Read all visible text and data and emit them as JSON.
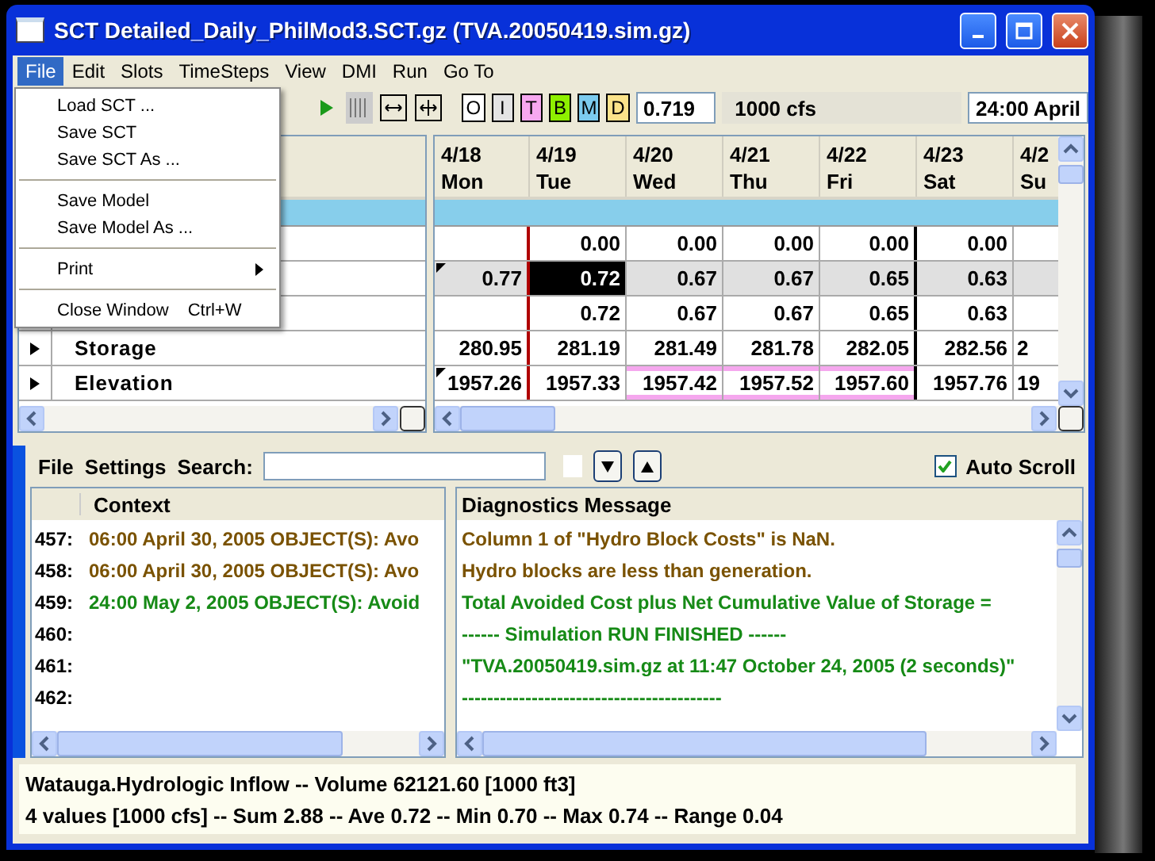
{
  "window": {
    "title": "SCT Detailed_Daily_PhilMod3.SCT.gz (TVA.20050419.sim.gz)"
  },
  "menu_bar": [
    {
      "label": "File",
      "selected": true
    },
    {
      "label": "Edit",
      "selected": false
    },
    {
      "label": "Slots",
      "selected": false
    },
    {
      "label": "TimeSteps",
      "selected": false
    },
    {
      "label": "View",
      "selected": false
    },
    {
      "label": "DMI",
      "selected": false
    },
    {
      "label": "Run",
      "selected": false
    },
    {
      "label": "Go To",
      "selected": false
    }
  ],
  "file_menu": [
    {
      "kind": "item",
      "label": "Load SCT ..."
    },
    {
      "kind": "item",
      "label": "Save SCT"
    },
    {
      "kind": "item",
      "label": "Save SCT As ..."
    },
    {
      "kind": "separator"
    },
    {
      "kind": "item",
      "label": "Save Model"
    },
    {
      "kind": "item",
      "label": "Save Model As ..."
    },
    {
      "kind": "separator"
    },
    {
      "kind": "submenu",
      "label": "Print"
    },
    {
      "kind": "separator"
    },
    {
      "kind": "item",
      "label": "Close Window",
      "shortcut": "Ctrl+W"
    }
  ],
  "toolbar": {
    "filters": [
      {
        "label": "O",
        "color": "#ffffff"
      },
      {
        "label": "I",
        "color": "#e4e4e4"
      },
      {
        "label": "T",
        "color": "#f7a8f0"
      },
      {
        "label": "B",
        "color": "#8ef000"
      },
      {
        "label": "M",
        "color": "#7ccbef"
      },
      {
        "label": "D",
        "color": "#fbe38a"
      }
    ],
    "value": "0.719",
    "units": "1000 cfs",
    "date": "24:00 April"
  },
  "table": {
    "columns": [
      {
        "date": "4/18",
        "day": "Mon"
      },
      {
        "date": "4/19",
        "day": "Tue"
      },
      {
        "date": "4/20",
        "day": "Wed"
      },
      {
        "date": "4/21",
        "day": "Thu"
      },
      {
        "date": "4/22",
        "day": "Fri"
      },
      {
        "date": "4/23",
        "day": "Sat"
      },
      {
        "date": "4/2",
        "day": "Su"
      }
    ],
    "rows": [
      {
        "expandable": false,
        "shaded": false,
        "cells": [
          null,
          {
            "text": "0.00",
            "kind": "plain",
            "selected": false
          },
          {
            "text": "0.00",
            "kind": "plain",
            "selected": false
          },
          {
            "text": "0.00",
            "kind": "plain",
            "selected": false
          },
          {
            "text": "0.00",
            "kind": "plain",
            "selected": false
          },
          {
            "text": "0.00",
            "kind": "plain",
            "selected": false
          },
          null
        ]
      },
      {
        "expandable": false,
        "shaded": true,
        "cells": [
          {
            "text": "0.77",
            "kind": "flagged",
            "selected": false
          },
          {
            "text": "0.72",
            "kind": "plain",
            "selected": true
          },
          {
            "text": "0.67",
            "kind": "plain",
            "selected": false
          },
          {
            "text": "0.67",
            "kind": "plain",
            "selected": false
          },
          {
            "text": "0.65",
            "kind": "plain",
            "selected": false
          },
          {
            "text": "0.63",
            "kind": "plain",
            "selected": false
          },
          null
        ]
      },
      {
        "expandable": false,
        "shaded": false,
        "cells": [
          null,
          {
            "text": "0.72",
            "kind": "plain",
            "selected": false
          },
          {
            "text": "0.67",
            "kind": "plain",
            "selected": false
          },
          {
            "text": "0.67",
            "kind": "plain",
            "selected": false
          },
          {
            "text": "0.65",
            "kind": "plain",
            "selected": false
          },
          {
            "text": "0.63",
            "kind": "plain",
            "selected": false
          },
          null
        ]
      },
      {
        "label": "Storage",
        "expandable": true,
        "shaded": false,
        "cells": [
          {
            "text": "280.95",
            "kind": "plain",
            "selected": false
          },
          {
            "text": "281.19",
            "kind": "plain",
            "selected": false
          },
          {
            "text": "281.49",
            "kind": "plain",
            "selected": false
          },
          {
            "text": "281.78",
            "kind": "plain",
            "selected": false
          },
          {
            "text": "282.05",
            "kind": "plain",
            "selected": false
          },
          {
            "text": "282.56",
            "kind": "plain",
            "selected": false
          },
          {
            "text": "2",
            "kind": "plain",
            "selected": false
          }
        ]
      },
      {
        "label": "Elevation",
        "expandable": true,
        "shaded": false,
        "cells": [
          {
            "text": "1957.26",
            "kind": "flagged",
            "selected": false
          },
          {
            "text": "1957.33",
            "kind": "plain",
            "selected": false
          },
          {
            "text": "1957.42",
            "kind": "highlighted",
            "selected": false
          },
          {
            "text": "1957.52",
            "kind": "highlighted",
            "selected": false
          },
          {
            "text": "1957.60",
            "kind": "highlighted",
            "selected": false
          },
          {
            "text": "1957.76",
            "kind": "plain",
            "selected": false
          },
          {
            "text": "19",
            "kind": "plain",
            "selected": false
          }
        ]
      }
    ]
  },
  "diagnostics": {
    "menu": [
      "File",
      "Settings"
    ],
    "search_label": "Search:",
    "auto_scroll": {
      "label": "Auto Scroll",
      "checked": true
    },
    "context_header": "Context",
    "message_header": "Diagnostics Message",
    "lines": [
      {
        "number": "457:",
        "context": "06:00 April 30, 2005 OBJECT(S): Avo",
        "message": "Column 1 of \"Hydro Block Costs\" is NaN.",
        "color": "#7a5200"
      },
      {
        "number": "458:",
        "context": "06:00 April 30, 2005 OBJECT(S): Avo",
        "message": "Hydro blocks are less than generation.",
        "color": "#7a5200"
      },
      {
        "number": "459:",
        "context": "24:00 May 2, 2005 OBJECT(S): Avoid",
        "message": "Total Avoided Cost plus Net Cumulative Value of Storage =",
        "color": "#168a16"
      },
      {
        "number": "460:",
        "message": "------ Simulation RUN FINISHED ------",
        "color": "#168a16"
      },
      {
        "number": "461:",
        "message": "\"TVA.20050419.sim.gz at 11:47 October 24, 2005 (2 seconds)\"",
        "color": "#168a16"
      },
      {
        "number": "462:",
        "message": "-----------------------------------------",
        "color": "#168a16"
      }
    ]
  },
  "status": [
    "Watauga.Hydrologic Inflow -- Volume 62121.60 [1000 ft3]",
    "4 values [1000 cfs] -- Sum 2.88 -- Ave 0.72 -- Min 0.70 -- Max 0.74 -- Range 0.04"
  ]
}
